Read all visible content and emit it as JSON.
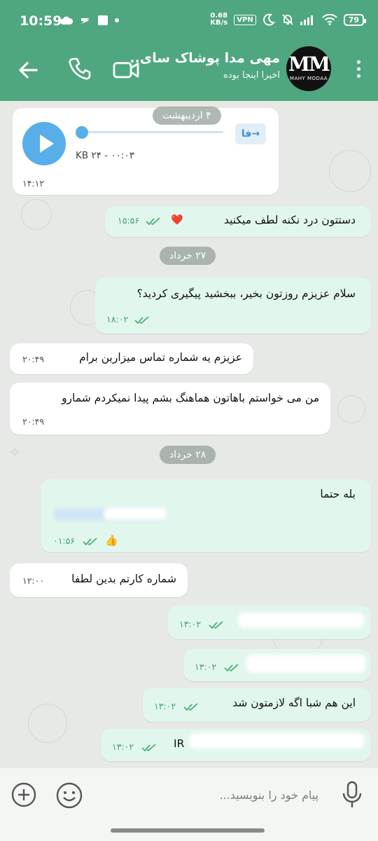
{
  "status_bar": {
    "time": "10:59",
    "speed_value": "0.68",
    "speed_unit": "KB/s",
    "vpn": "VPN",
    "battery": "79"
  },
  "header": {
    "title": "مهی مدا پوشاک سای..",
    "subtitle": "اخیرا اینجا بوده",
    "avatar_text": "MM",
    "avatar_brand": "MAHY MODAA"
  },
  "messages": {
    "date_1": "۴ اردیبهشت",
    "voice": {
      "badge": "فا",
      "meta": "۰۰:۰۳ - ۲۴ KB",
      "time": "۱۴:۱۲"
    },
    "m1": {
      "text": "دستتون درد نکنه لطف میکنید",
      "emoji": "❤️",
      "time": "۱۵:۵۶"
    },
    "date_2": "۲۷ خرداد",
    "m2": {
      "text": "سلام عزیزم روزتون بخیر، ببخشید پیگیری کردید؟",
      "time": "۱۸:۰۲"
    },
    "m3": {
      "text": "عزیزم یه شماره تماس میزارین برام",
      "time": "۲۰:۴۹"
    },
    "m4": {
      "text": "من می خواستم باهاتون هماهنگ بشم پیدا نمیکردم شمارو",
      "time": "۲۰:۴۹"
    },
    "date_3": "۲۸ خرداد",
    "m5": {
      "text": "بله حتما",
      "emoji": "👍",
      "time": "۰۱:۵۶"
    },
    "m6": {
      "text": "شماره کارتم بدین لطفا",
      "time": "۱۲:۰۰"
    },
    "m7": {
      "time": "۱۳:۰۲"
    },
    "m8": {
      "time": "۱۳:۰۲"
    },
    "m9": {
      "text": "این هم شبا اگه لازمتون شد",
      "time": "۱۳:۰۲"
    },
    "m10": {
      "text": "IR",
      "time": "۱۳:۰۲"
    }
  },
  "input": {
    "placeholder": "پیام خود را بنویسید..."
  },
  "colors": {
    "header": "#4fa77f",
    "outgoing_bubble": "#e1f6ed",
    "incoming_bubble": "#ffffff",
    "accent_blue": "#58aee8"
  }
}
